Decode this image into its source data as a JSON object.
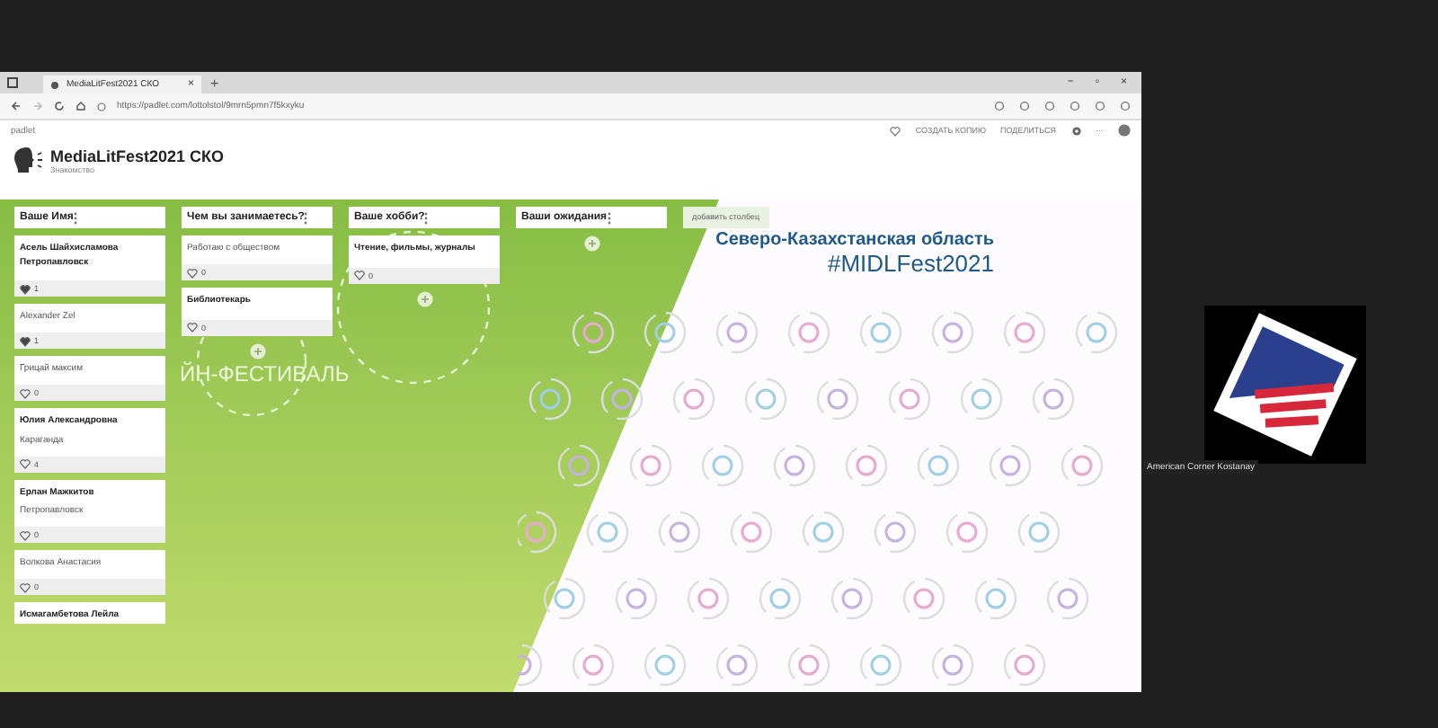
{
  "browser": {
    "tab_title": "MediaLitFest2021 СКО",
    "tab_close": "×",
    "new_tab": "+",
    "url": "https://padlet.com/lottolstol/9mrn5pmn7f5kxyku",
    "window_controls": [
      "−",
      "▫",
      "×"
    ]
  },
  "padlet": {
    "brand": "padlet",
    "title": "MediaLitFest2021 СКО",
    "subtitle": "Знакомство",
    "actions": [
      "СОЗДАТЬ КОПИЮ",
      "ПОДЕЛИТЬСЯ"
    ],
    "more": "···"
  },
  "board": {
    "background_text": "ЙН-ФЕСТИВАЛЬ",
    "region_title": "Северо-Казахстанская область",
    "hashtag": "#MIDLFest2021",
    "add_column": "добавить столбец",
    "columns": [
      {
        "title": "Ваше Имя",
        "cards": [
          {
            "title": "Асель Шайхисламова Петропавловск",
            "likes": "1",
            "liked": true
          },
          {
            "body": "Alexander Zel",
            "likes": "1",
            "liked": true
          },
          {
            "body": "Грицай максим",
            "likes": "0",
            "liked": false
          },
          {
            "title": "Юлия Александровна",
            "body": "Караганда",
            "likes": "4",
            "liked": false
          },
          {
            "title": "Ерлан Мажкитов",
            "body": "Петропавловск",
            "likes": "0",
            "liked": false
          },
          {
            "body": "Волкова Анастасия",
            "likes": "0",
            "liked": false
          },
          {
            "title": "Исмагамбетова Лейла"
          }
        ]
      },
      {
        "title": "Чем вы занимаетесь?",
        "cards": [
          {
            "body": "Работаю с обществом",
            "likes": "0",
            "liked": false
          },
          {
            "title": "Библиотекарь",
            "likes": "0",
            "liked": false
          }
        ]
      },
      {
        "title": "Ваше хобби?",
        "cards": [
          {
            "title": "Чтение, фильмы, журналы",
            "likes": "0",
            "liked": false
          }
        ]
      },
      {
        "title": "Ваши ожидания"
      }
    ]
  },
  "participant": {
    "name": "American Corner Kostanay"
  }
}
